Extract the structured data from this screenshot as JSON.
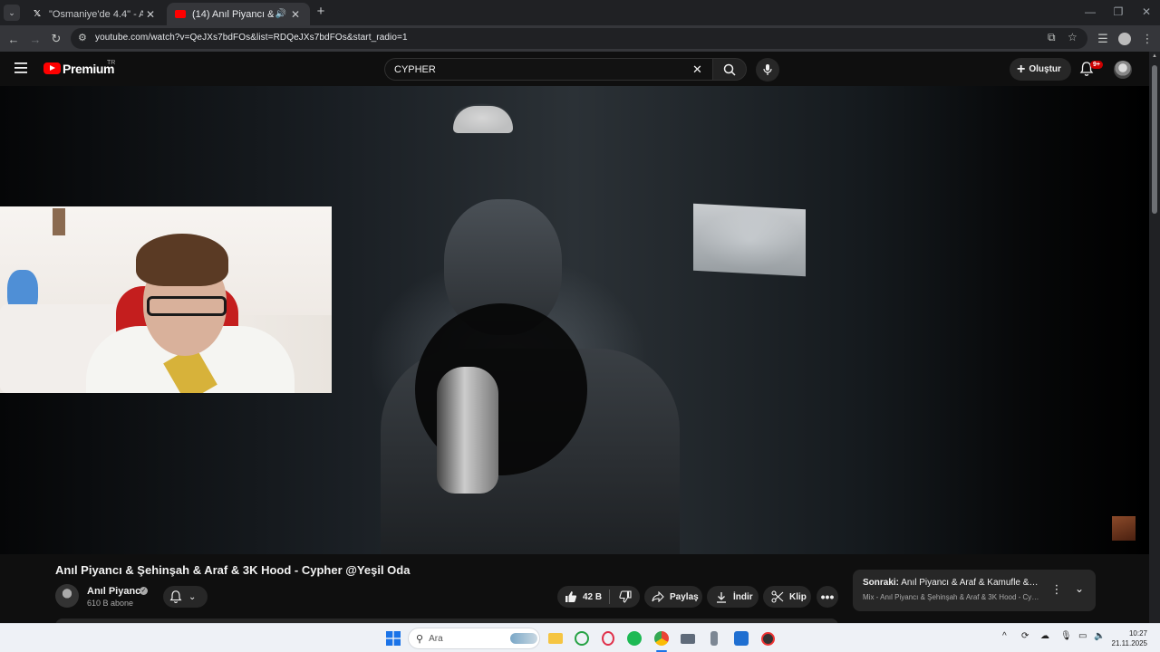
{
  "browser": {
    "tabs": [
      {
        "label": "\"Osmaniye'de 4.4\" - Arama / X",
        "favicon": "x-logo-icon",
        "active": false
      },
      {
        "label": "(14) Anıl Piyancı & Şehinşah",
        "favicon": "youtube-icon",
        "active": true,
        "audio": true
      }
    ],
    "url": "youtube.com/watch?v=QeJXs7bdFOs&list=RDQeJXs7bdFOs&start_radio=1"
  },
  "youtube": {
    "logo_text": "Premium",
    "logo_country": "TR",
    "search_value": "CYPHER",
    "create_label": "Oluştur",
    "notification_badge": "9+",
    "video": {
      "title": "Anıl Piyancı & Şehinşah & Araf & 3K Hood - Cypher @Yeşil Oda",
      "channel": "Anıl Piyancı",
      "subscribers": "610 B abone",
      "likes": "42 B",
      "share_label": "Paylaş",
      "download_label": "İndir",
      "clip_label": "Klip"
    },
    "up_next": {
      "prefix": "Sonraki:",
      "title": "Anıl Piyancı & Araf & Kamufle & Red ...",
      "subtitle": "Mix - Anıl Piyancı & Şehinşah & Araf & 3K Hood - Cyp..."
    }
  },
  "taskbar": {
    "search_placeholder": "Ara",
    "time": "10:27",
    "date": "21.11.2025"
  },
  "colors": {
    "yt_red": "#ff0000",
    "bg": "#0f0f0f",
    "pill": "#272727",
    "chrome_tab_bar": "#202124"
  }
}
